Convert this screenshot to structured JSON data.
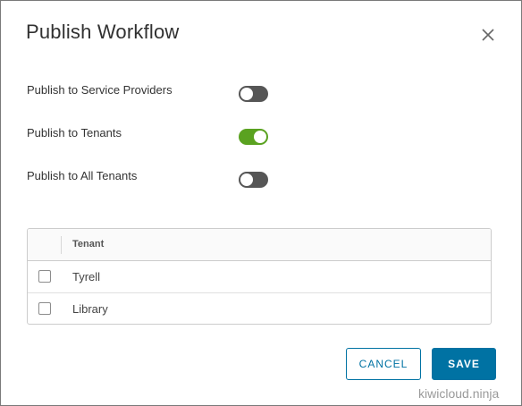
{
  "dialog": {
    "title": "Publish Workflow"
  },
  "options": [
    {
      "label": "Publish to Service Providers",
      "enabled": false
    },
    {
      "label": "Publish to Tenants",
      "enabled": true
    },
    {
      "label": "Publish to All Tenants",
      "enabled": false
    }
  ],
  "tenant_grid": {
    "column_header": "Tenant",
    "rows": [
      {
        "name": "Tyrell",
        "checked": false
      },
      {
        "name": "Library",
        "checked": false
      }
    ]
  },
  "actions": {
    "cancel_label": "CANCEL",
    "save_label": "SAVE"
  },
  "watermark": "kiwicloud.ninja",
  "colors": {
    "toggle_on": "#5aa220",
    "toggle_off": "#565656",
    "primary": "#0072a3"
  }
}
